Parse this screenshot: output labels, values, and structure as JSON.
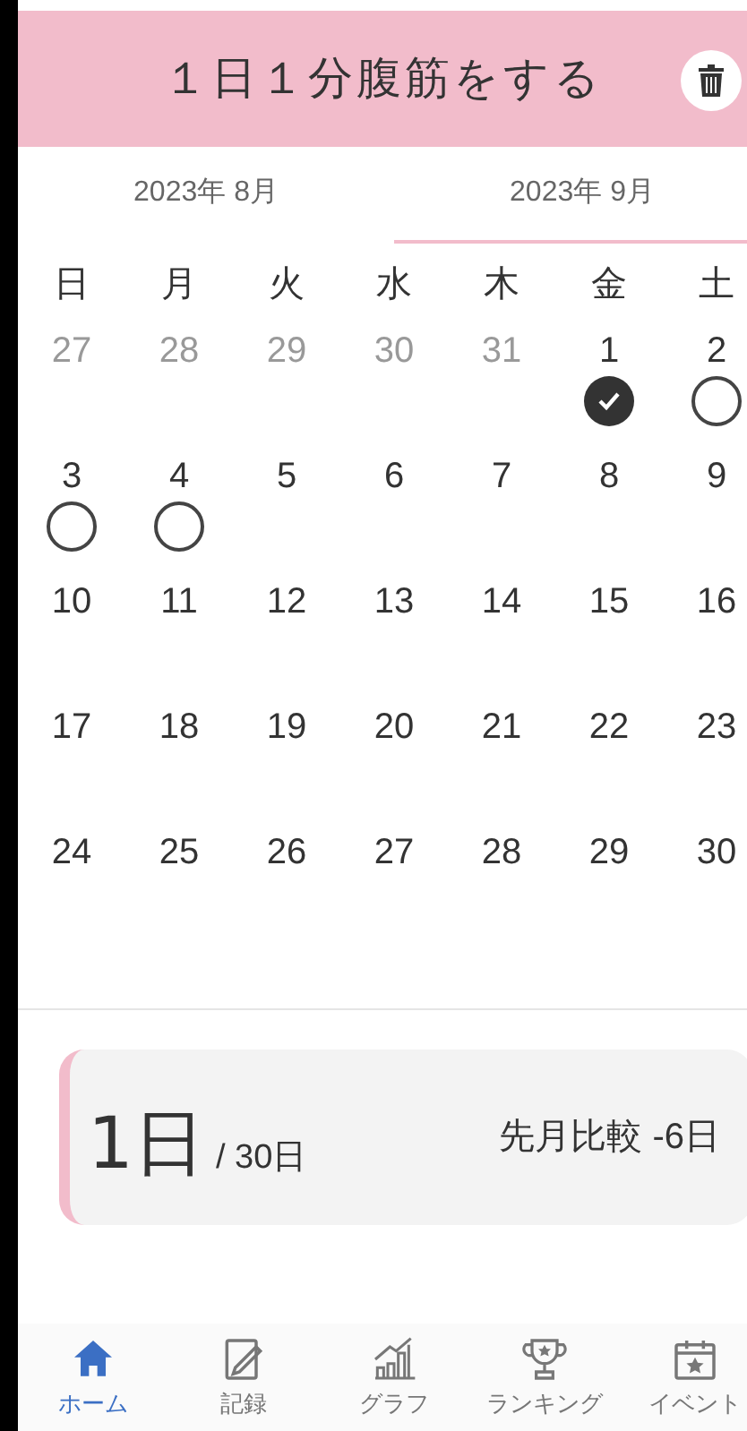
{
  "header": {
    "title": "１日１分腹筋をする"
  },
  "tabs": [
    {
      "label": "2023年 8月",
      "selected": false
    },
    {
      "label": "2023年 9月",
      "selected": true
    }
  ],
  "weekdays": [
    "日",
    "月",
    "火",
    "水",
    "木",
    "金",
    "土"
  ],
  "weeks": [
    [
      {
        "day": "27",
        "outside": true
      },
      {
        "day": "28",
        "outside": true
      },
      {
        "day": "29",
        "outside": true
      },
      {
        "day": "30",
        "outside": true
      },
      {
        "day": "31",
        "outside": true
      },
      {
        "day": "1",
        "outside": false,
        "checked": true
      },
      {
        "day": "2",
        "outside": false,
        "checked": false
      }
    ],
    [
      {
        "day": "3",
        "outside": false,
        "checked": false
      },
      {
        "day": "4",
        "outside": false,
        "checked": false
      },
      {
        "day": "5",
        "outside": false
      },
      {
        "day": "6",
        "outside": false
      },
      {
        "day": "7",
        "outside": false
      },
      {
        "day": "8",
        "outside": false
      },
      {
        "day": "9",
        "outside": false
      }
    ],
    [
      {
        "day": "10",
        "outside": false
      },
      {
        "day": "11",
        "outside": false
      },
      {
        "day": "12",
        "outside": false
      },
      {
        "day": "13",
        "outside": false
      },
      {
        "day": "14",
        "outside": false
      },
      {
        "day": "15",
        "outside": false
      },
      {
        "day": "16",
        "outside": false
      }
    ],
    [
      {
        "day": "17",
        "outside": false
      },
      {
        "day": "18",
        "outside": false
      },
      {
        "day": "19",
        "outside": false
      },
      {
        "day": "20",
        "outside": false
      },
      {
        "day": "21",
        "outside": false
      },
      {
        "day": "22",
        "outside": false
      },
      {
        "day": "23",
        "outside": false
      }
    ],
    [
      {
        "day": "24",
        "outside": false
      },
      {
        "day": "25",
        "outside": false
      },
      {
        "day": "26",
        "outside": false
      },
      {
        "day": "27",
        "outside": false
      },
      {
        "day": "28",
        "outside": false
      },
      {
        "day": "29",
        "outside": false
      },
      {
        "day": "30",
        "outside": false
      }
    ]
  ],
  "summary": {
    "count": "1日",
    "total": "/ 30日",
    "comparison": "先月比較 -6日"
  },
  "nav": [
    {
      "label": "ホーム",
      "kind": "home",
      "selected": true
    },
    {
      "label": "記録",
      "kind": "record",
      "selected": false
    },
    {
      "label": "グラフ",
      "kind": "graph",
      "selected": false
    },
    {
      "label": "ランキング",
      "kind": "ranking",
      "selected": false
    },
    {
      "label": "イベント",
      "kind": "event",
      "selected": false
    }
  ]
}
